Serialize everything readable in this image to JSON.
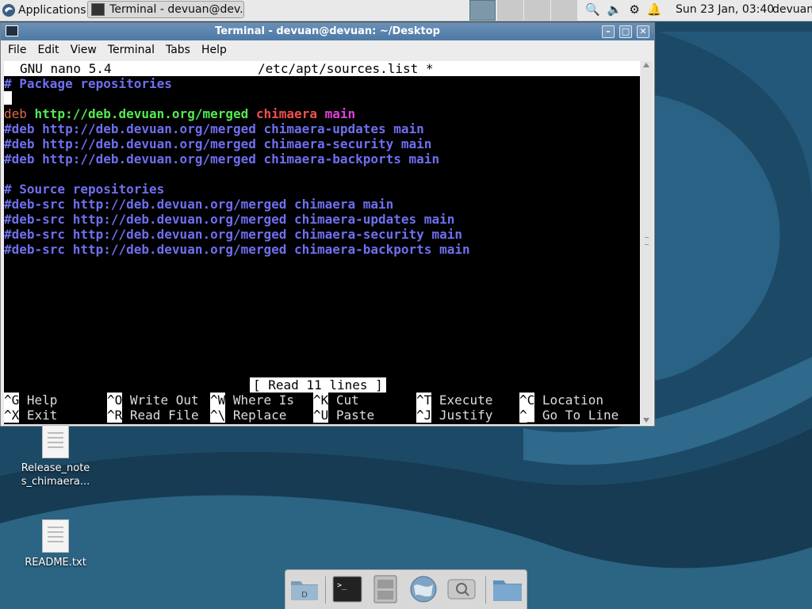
{
  "panel": {
    "applications_label": "Applications",
    "task_label": "Terminal - devuan@dev...",
    "clock": "Sun 23 Jan, 03:40",
    "user": "devuan"
  },
  "window": {
    "title": "Terminal - devuan@devuan: ~/Desktop",
    "menu": [
      "File",
      "Edit",
      "View",
      "Terminal",
      "Tabs",
      "Help"
    ]
  },
  "nano": {
    "version": "GNU nano 5.4",
    "filename": "/etc/apt/sources.list *",
    "status": "[ Read 11 lines ]",
    "lines": {
      "l1": "# Package repositories",
      "l3_prefix": "deb ",
      "l3_url": "http://deb.devuan.org/merged ",
      "l3_suite": "chimaera ",
      "l3_comp": "main",
      "l4": "#deb http://deb.devuan.org/merged chimaera-updates main",
      "l5": "#deb http://deb.devuan.org/merged chimaera-security main",
      "l6": "#deb http://deb.devuan.org/merged chimaera-backports main",
      "l8": "# Source repositories",
      "l9": "#deb-src http://deb.devuan.org/merged chimaera main",
      "l10": "#deb-src http://deb.devuan.org/merged chimaera-updates main",
      "l11": "#deb-src http://deb.devuan.org/merged chimaera-security main",
      "l12": "#deb-src http://deb.devuan.org/merged chimaera-backports main"
    },
    "shortcuts": [
      {
        "key": "^G",
        "label": "Help"
      },
      {
        "key": "^O",
        "label": "Write Out"
      },
      {
        "key": "^W",
        "label": "Where Is"
      },
      {
        "key": "^K",
        "label": "Cut"
      },
      {
        "key": "^T",
        "label": "Execute"
      },
      {
        "key": "^C",
        "label": "Location"
      },
      {
        "key": "^X",
        "label": "Exit"
      },
      {
        "key": "^R",
        "label": "Read File"
      },
      {
        "key": "^\\",
        "label": "Replace"
      },
      {
        "key": "^U",
        "label": "Paste"
      },
      {
        "key": "^J",
        "label": "Justify"
      },
      {
        "key": "^_",
        "label": "Go To Line"
      }
    ]
  },
  "desktop": {
    "icons": [
      {
        "label_line1": "Release_note",
        "label_line2": "s_chimaera..."
      },
      {
        "label_line1": "README.txt",
        "label_line2": ""
      }
    ]
  },
  "colors": {
    "desktop_bg": "#1b4560",
    "titlebar": "#5a84ae",
    "comment_blue": "#6f6ff0",
    "url_green": "#55e855",
    "suite_red": "#f05050",
    "component_magenta": "#e040e0"
  }
}
